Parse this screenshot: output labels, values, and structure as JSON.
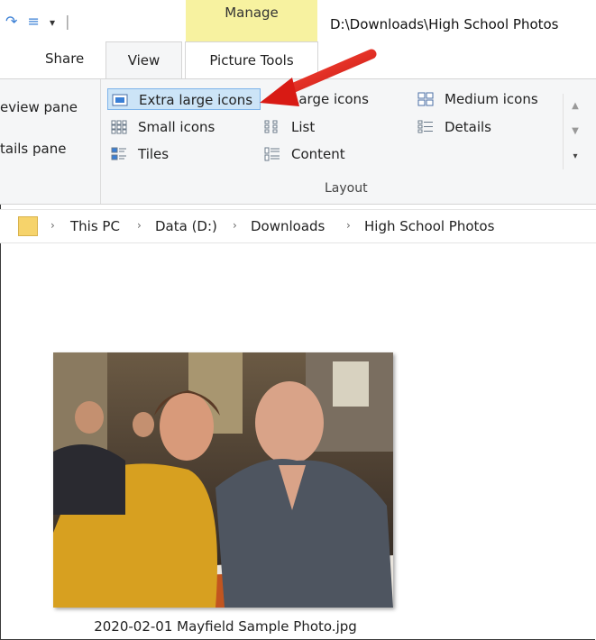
{
  "window": {
    "context_tab": "Manage",
    "path_title": "D:\\Downloads\\High School Photos"
  },
  "tabs": {
    "share": "Share",
    "view": "View",
    "picture_tools": "Picture Tools"
  },
  "panes": {
    "preview": "eview pane",
    "details": "tails pane"
  },
  "layout": {
    "group_label": "Layout",
    "items": [
      {
        "label": "Extra large icons",
        "icon": "extra-large-icons-icon",
        "selected": true
      },
      {
        "label": "Large icons",
        "icon": "large-icons-icon",
        "selected": false
      },
      {
        "label": "Medium icons",
        "icon": "medium-icons-icon",
        "selected": false
      },
      {
        "label": "Small icons",
        "icon": "small-icons-icon",
        "selected": false
      },
      {
        "label": "List",
        "icon": "list-icon",
        "selected": false
      },
      {
        "label": "Details",
        "icon": "details-icon",
        "selected": false
      },
      {
        "label": "Tiles",
        "icon": "tiles-icon",
        "selected": false
      },
      {
        "label": "Content",
        "icon": "content-icon",
        "selected": false
      }
    ]
  },
  "breadcrumb": [
    "This PC",
    "Data (D:)",
    "Downloads",
    "High School Photos"
  ],
  "files": [
    {
      "name": "2020-02-01 Mayfield Sample Photo.jpg"
    }
  ],
  "colors": {
    "manage_tab": "#f7f2a0",
    "selection": "#cce4f7",
    "arrow": "#e0201c",
    "folder": "#f6d36b"
  }
}
